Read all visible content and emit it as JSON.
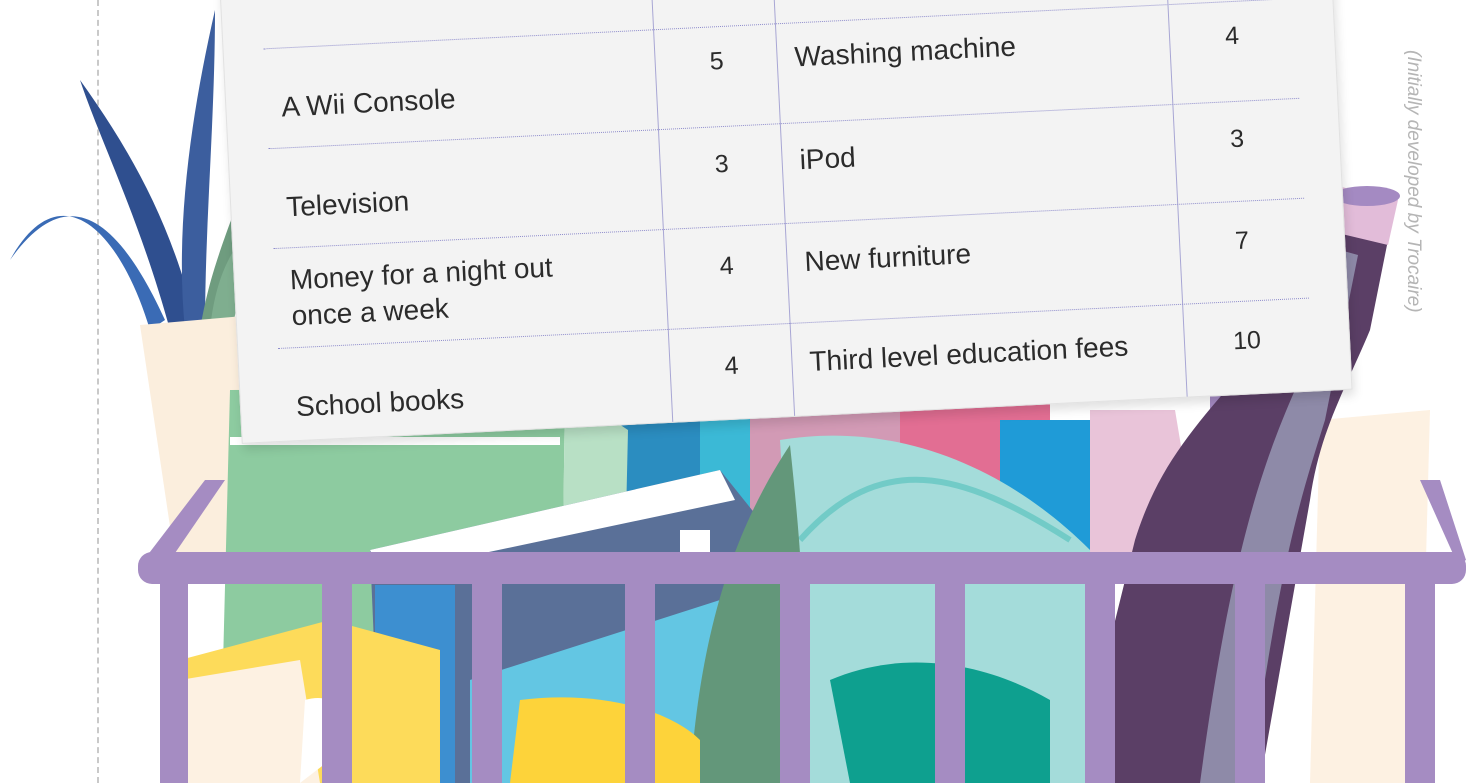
{
  "credit": "(Initially developed by Trocaire)",
  "list": {
    "rows": [
      {
        "left_item": "A Wii Console",
        "left_value": "5",
        "right_item": "Washing machine",
        "right_value": "4"
      },
      {
        "left_item": "Television",
        "left_value": "3",
        "right_item": "iPod",
        "right_value": "3"
      },
      {
        "left_item": "Money for a night out",
        "left_item_line2": "once a week",
        "left_value": "4",
        "right_item": "New furniture",
        "right_value": "7"
      },
      {
        "left_item": "School books",
        "left_value": "4",
        "right_item": "Third level education fees",
        "right_value": "10"
      }
    ]
  },
  "colors": {
    "basket": "#a58cc2",
    "paper": "#f3f3f3",
    "rule_lines": "#8f8dcc",
    "wine_bottle": "#5b3f66",
    "plant": "#3a6bb5"
  },
  "icons": [
    "plant-icon",
    "wine-bottle-icon",
    "basket-icon",
    "book-icon"
  ]
}
